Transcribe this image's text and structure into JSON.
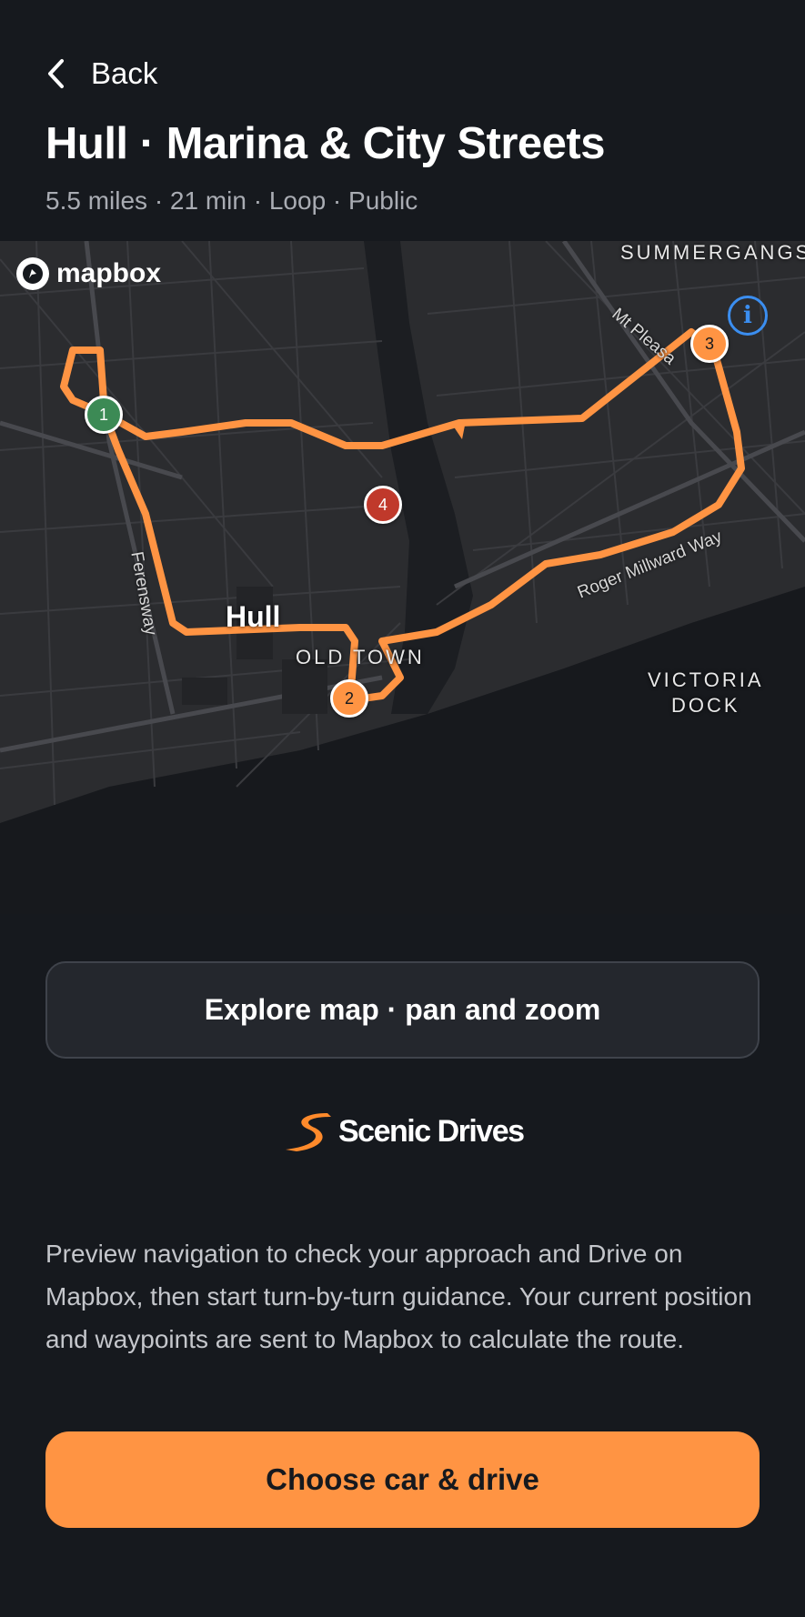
{
  "header": {
    "back_label": "Back",
    "title": "Hull · Marina & City Streets",
    "subtitle": "5.5 miles · 21 min · Loop · Public"
  },
  "map": {
    "attribution": "mapbox",
    "info_icon_glyph": "i",
    "area_labels": {
      "summergangs": "SUMMERGANGS",
      "old_town": "OLD TOWN",
      "victoria_dock_1": "VICTORIA",
      "victoria_dock_2": "DOCK"
    },
    "city_label": "Hull",
    "street_labels": {
      "mt_pleasant": "Mt Pleasa",
      "roger_millward": "Roger Millward Way",
      "ferensway": "Ferensway"
    },
    "waypoints": [
      {
        "label": "1",
        "color": "#3c8a55"
      },
      {
        "label": "2",
        "color": "#ff9443"
      },
      {
        "label": "3",
        "color": "#ff9443"
      },
      {
        "label": "4",
        "color": "#c0392b"
      }
    ],
    "route_color": "#ff9443"
  },
  "explore_button": {
    "label": "Explore map · pan and zoom"
  },
  "brand": {
    "name": "Scenic Drives",
    "accent": "#ff8a2b"
  },
  "description": "Preview navigation to check your approach and Drive on Mapbox, then start turn-by-turn guidance. Your current position and waypoints are sent to Mapbox to calculate the route.",
  "cta": {
    "label": "Choose car & drive"
  }
}
